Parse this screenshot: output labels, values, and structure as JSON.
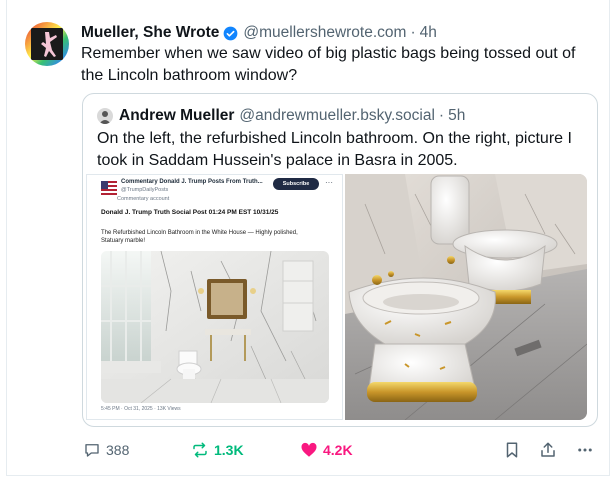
{
  "post": {
    "author_name": "Mueller, She Wrote",
    "handle": "@muellershewrote.com",
    "separator": "·",
    "time": "4h",
    "text": "Remember when we saw video of big plastic bags being tossed out of the Lincoln bathroom window?"
  },
  "quote": {
    "author_name": "Andrew Mueller",
    "handle": "@andrewmueller.bsky.social",
    "separator": "·",
    "time": "5h",
    "text": "On the left, the refurbished Lincoln bathroom. On the right, picture I took in Saddam Hussein's palace in Basra in 2005.",
    "embedded_screenshot": {
      "account_name": "Commentary Donald J. Trump Posts From Truth...",
      "account_handle": "@TrumpDailyPosts",
      "account_type": "Commentary account",
      "subscribe_label": "Subscribe",
      "more": "···",
      "title": "Donald J. Trump Truth Social Post 01:24 PM EST 10/31/25",
      "description": "The Refurbished Lincoln Bathroom in the White House — Highly polished, Statuary marble!",
      "footer": "5:45 PM · Oct 31, 2025 · 13K Views"
    }
  },
  "actions": {
    "replies": "388",
    "reposts": "1.3K",
    "likes": "4.2K"
  },
  "colors": {
    "accent_blue": "#1185fe",
    "repost_green": "#00ba7c",
    "like_pink": "#f91880",
    "muted_text": "#536471",
    "border": "#cfd9de"
  },
  "icons": [
    "verified-badge-icon",
    "reply-icon",
    "repost-icon",
    "heart-icon",
    "bookmark-icon",
    "share-icon",
    "more-icon"
  ]
}
